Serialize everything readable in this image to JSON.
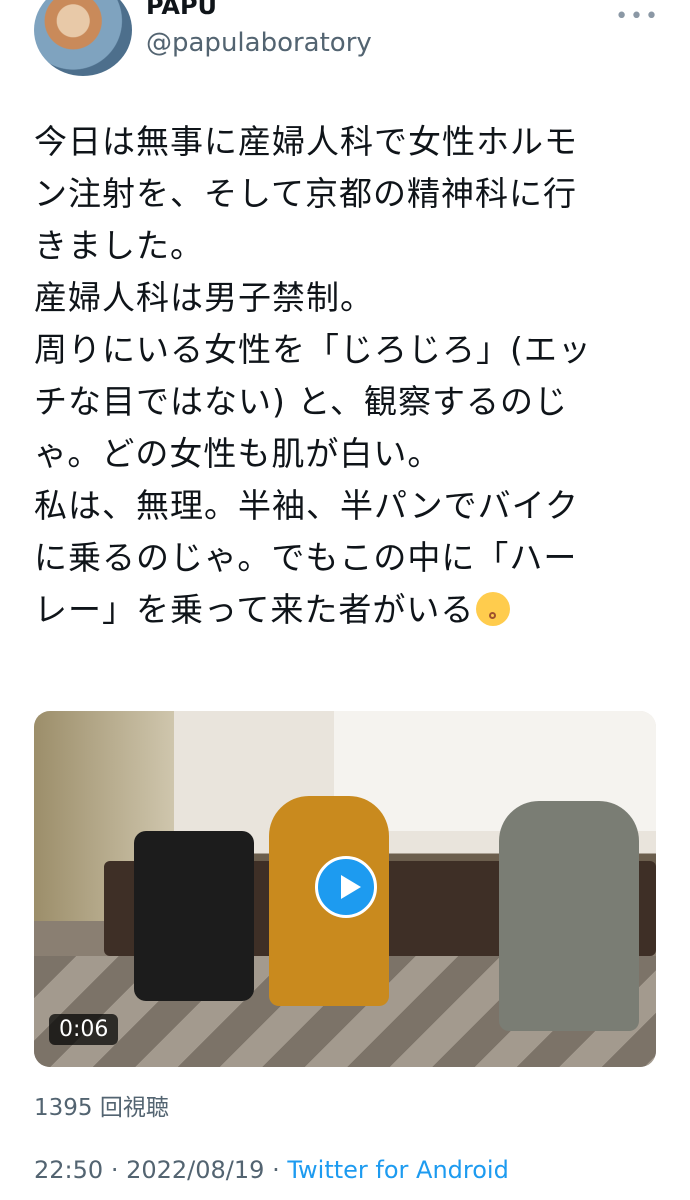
{
  "tweet": {
    "author_name": "PAPU",
    "author_handle": "@papulaboratory",
    "text_lines": [
      "今日は無事に産婦人科で女性ホルモ",
      "ン注射を、そして京都の精神科に行",
      "きました。",
      "産婦人科は男子禁制。",
      "周りにいる女性を「じろじろ」(エッ",
      "チな目ではない) と、観察するのじ",
      "ゃ。どの女性も肌が白い。",
      "私は、無理。半袖、半パンでバイク",
      "に乗るのじゃ。でもこの中に「ハー",
      "レー」を乗って来た者がいる"
    ],
    "emoji": "kissing-face-icon"
  },
  "video": {
    "duration": "0:06",
    "views": "1395 回視聴"
  },
  "meta": {
    "time": "22:50",
    "separator": "·",
    "date": "2022/08/19",
    "source": "Twitter for Android"
  },
  "colors": {
    "accent": "#1d9bf0",
    "secondary_text": "#536471"
  }
}
